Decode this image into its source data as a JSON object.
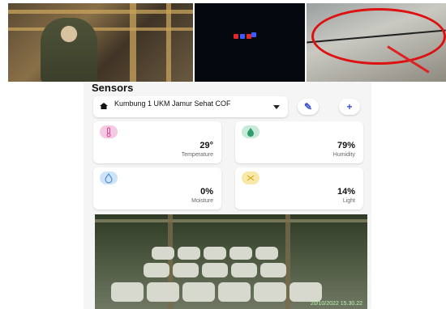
{
  "photos": [
    {
      "name": "worker-photo"
    },
    {
      "name": "sensor-device-photo"
    },
    {
      "name": "sensor-installation-photo"
    }
  ],
  "sensors_screen": {
    "title": "Sensors",
    "selected_location": "Kumbung 1 UKM Jamur Sehat COF",
    "cards": [
      {
        "value": "29°",
        "label": "Temperature",
        "icon": "thermometer-icon",
        "color": "#f6c9e3"
      },
      {
        "value": "79%",
        "label": "Humidity",
        "icon": "humidity-icon",
        "color": "#c7ead9"
      },
      {
        "value": "0%",
        "label": "Moisture",
        "icon": "water-drop-icon",
        "color": "#cde3f7"
      },
      {
        "value": "14%",
        "label": "Light",
        "icon": "light-icon",
        "color": "#f8e9a8"
      }
    ],
    "camera_timestamp": "20/10/2022 15.30.22"
  },
  "colors": {
    "accent": "#3a4fd0"
  }
}
